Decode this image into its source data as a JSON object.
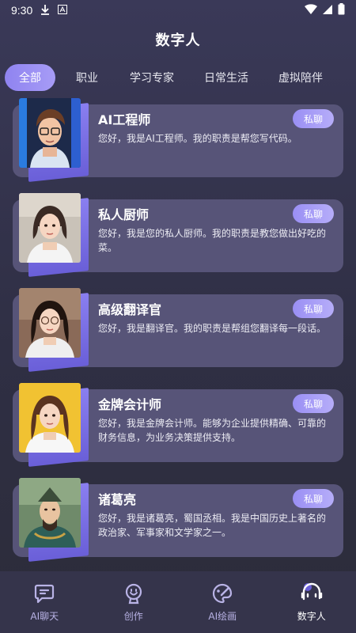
{
  "status_bar": {
    "time": "9:30",
    "icons": [
      "download-icon",
      "a-badge-icon",
      "wifi-icon",
      "signal-icon",
      "battery-icon"
    ]
  },
  "header": {
    "title": "数字人"
  },
  "tabs": [
    {
      "label": "全部",
      "active": true
    },
    {
      "label": "职业",
      "active": false
    },
    {
      "label": "学习专家",
      "active": false
    },
    {
      "label": "日常生活",
      "active": false
    },
    {
      "label": "虚拟陪伴",
      "active": false
    }
  ],
  "cards": [
    {
      "name": "AI工程师",
      "button": "私聊",
      "desc": "您好，我是AI工程师。我的职责是帮您写代码。"
    },
    {
      "name": "私人厨师",
      "button": "私聊",
      "desc": "您好，我是您的私人厨师。我的职责是教您做出好吃的菜。"
    },
    {
      "name": "高级翻译官",
      "button": "私聊",
      "desc": "您好，我是翻译官。我的职责是帮组您翻译每一段话。"
    },
    {
      "name": "金牌会计师",
      "button": "私聊",
      "desc": "您好，我是金牌会计师。能够为企业提供精确、可靠的财务信息，为业务决策提供支持。"
    },
    {
      "name": "诸葛亮",
      "button": "私聊",
      "desc": "您好，我是诸葛亮，蜀国丞相。我是中国历史上著名的政治家、军事家和文学家之一。"
    }
  ],
  "bottom_nav": [
    {
      "label": "AI聊天",
      "icon": "chat-icon",
      "active": false
    },
    {
      "label": "创作",
      "icon": "create-icon",
      "active": false
    },
    {
      "label": "AI绘画",
      "icon": "paint-icon",
      "active": false
    },
    {
      "label": "数字人",
      "icon": "digital-human-icon",
      "active": true
    }
  ],
  "colors": {
    "accent": "#9a8ff4",
    "card_bg": "#575478",
    "nav_bg": "#35344b",
    "inactive_nav": "#b9b3e6"
  }
}
